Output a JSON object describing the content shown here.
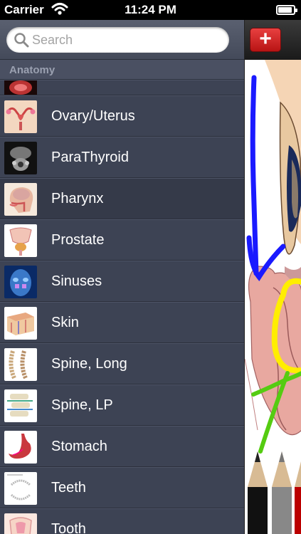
{
  "status_bar": {
    "carrier": "Carrier",
    "time": "11:24 PM",
    "wifi_icon": "wifi-icon",
    "battery_icon": "battery-icon"
  },
  "search": {
    "placeholder": "Search",
    "value": ""
  },
  "section": {
    "title": "Anatomy"
  },
  "items": [
    {
      "label": "",
      "thumb": "organ-partial"
    },
    {
      "label": "Ovary/Uterus",
      "thumb": "uterus"
    },
    {
      "label": "ParaThyroid",
      "thumb": "parathyroid"
    },
    {
      "label": "Pharynx",
      "thumb": "pharynx",
      "selected": true
    },
    {
      "label": "Prostate",
      "thumb": "prostate"
    },
    {
      "label": "Sinuses",
      "thumb": "sinuses"
    },
    {
      "label": "Skin",
      "thumb": "skin"
    },
    {
      "label": "Spine, Long",
      "thumb": "spine-long"
    },
    {
      "label": "Spine, LP",
      "thumb": "spine-lp"
    },
    {
      "label": "Stomach",
      "thumb": "stomach"
    },
    {
      "label": "Teeth",
      "thumb": "teeth"
    },
    {
      "label": "Tooth",
      "thumb": "tooth"
    }
  ],
  "toolbar": {
    "add_label": "+"
  },
  "colors": {
    "sidebar_bg": "#3d4354",
    "selected_row": "#353a49",
    "add_button": "#d42020",
    "annotation_blue": "#1a1aff",
    "annotation_yellow": "#ffee00",
    "annotation_green": "#55cc11"
  }
}
